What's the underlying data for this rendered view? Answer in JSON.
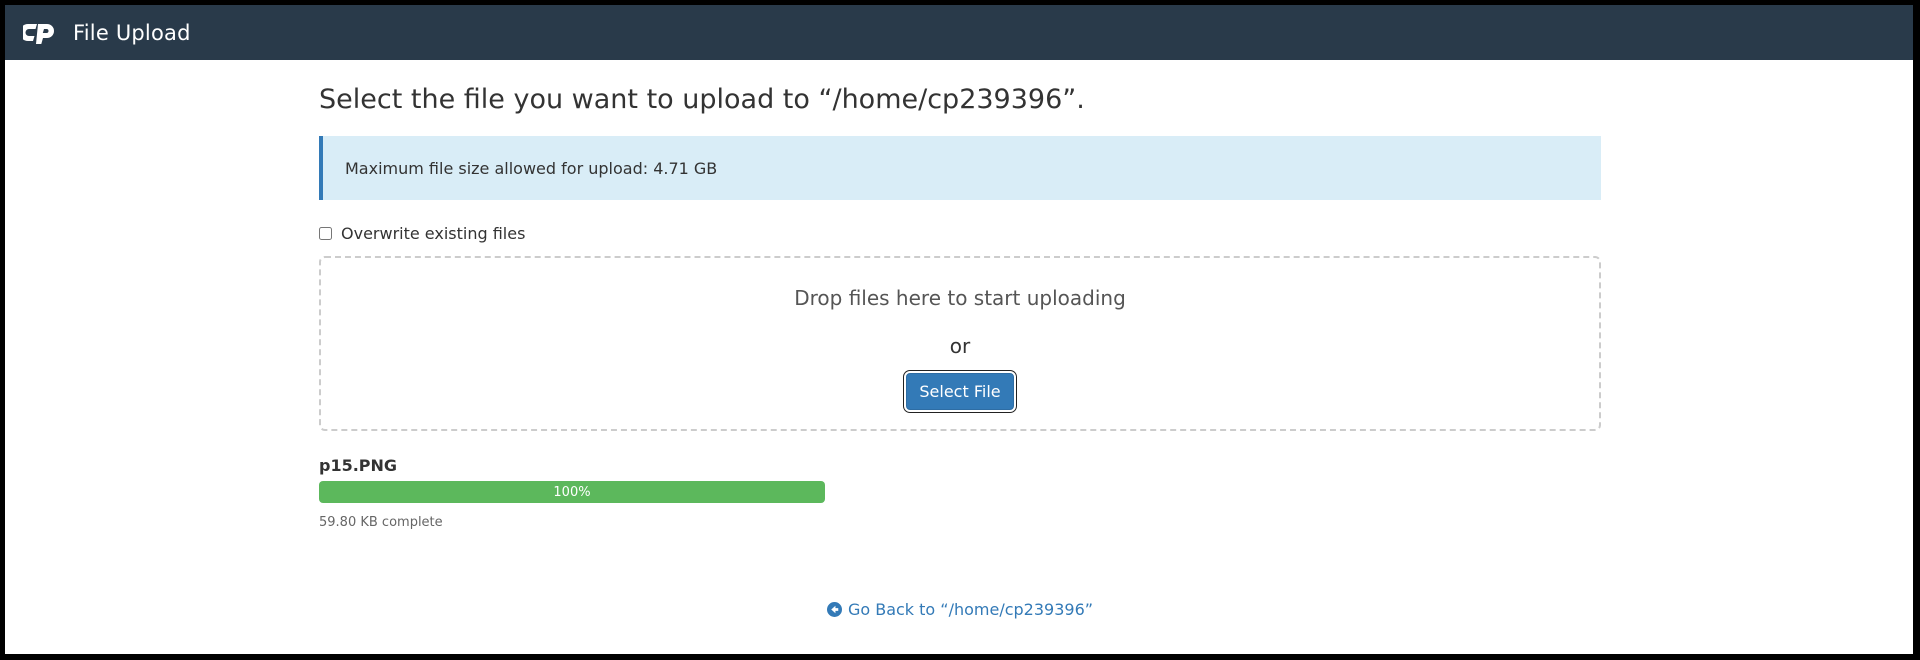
{
  "header": {
    "title": "File Upload",
    "logo_icon": "cpanel-logo-icon"
  },
  "page": {
    "heading": "Select the file you want to upload to “/home/cp239396”."
  },
  "info": {
    "text": "Maximum file size allowed for upload: 4.71 GB"
  },
  "options": {
    "overwrite_label": "Overwrite existing files",
    "overwrite_checked": false
  },
  "dropzone": {
    "drop_text": "Drop files here to start uploading",
    "or_text": "or",
    "button_label": "Select File"
  },
  "upload": {
    "file_name": "p15.PNG",
    "progress_percent": 100,
    "progress_label": "100%",
    "status": "59.80 KB complete"
  },
  "footer": {
    "back_link": "Go Back to “/home/cp239396”",
    "back_icon": "arrow-circle-left-icon"
  },
  "colors": {
    "header_bg": "#293a4a",
    "accent": "#337ab7",
    "info_bg": "#d9edf7",
    "success": "#5cb85c"
  }
}
